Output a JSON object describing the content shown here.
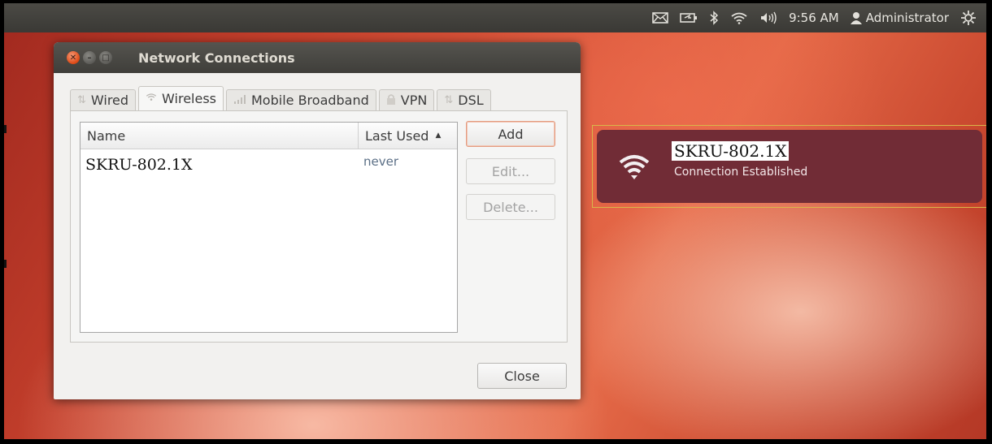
{
  "panel": {
    "time": "9:56 AM",
    "user": "Administrator",
    "icons": [
      "mail-icon",
      "battery-icon",
      "bluetooth-icon",
      "wifi-icon",
      "volume-icon",
      "user-icon",
      "gear-icon"
    ]
  },
  "window": {
    "title": "Network Connections",
    "tabs": [
      {
        "label": "Wired",
        "icon": "wired-icon"
      },
      {
        "label": "Wireless",
        "icon": "wifi-icon"
      },
      {
        "label": "Mobile Broadband",
        "icon": "signal-icon"
      },
      {
        "label": "VPN",
        "icon": "lock-icon"
      },
      {
        "label": "DSL",
        "icon": "wired-icon"
      }
    ],
    "active_tab": "Wireless",
    "list": {
      "columns": [
        "Name",
        "Last Used"
      ],
      "rows": [
        {
          "name": "SKRU-802.1X",
          "last_used": "never"
        }
      ]
    },
    "buttons": {
      "add": "Add",
      "edit": "Edit...",
      "delete": "Delete...",
      "close": "Close"
    }
  },
  "notification": {
    "title": "SKRU-802.1X",
    "body": "Connection Established",
    "icon": "wifi-icon"
  },
  "colors": {
    "panel": "#3f3e3a",
    "notification_bg": "#712c36",
    "accent": "#dd4814"
  }
}
